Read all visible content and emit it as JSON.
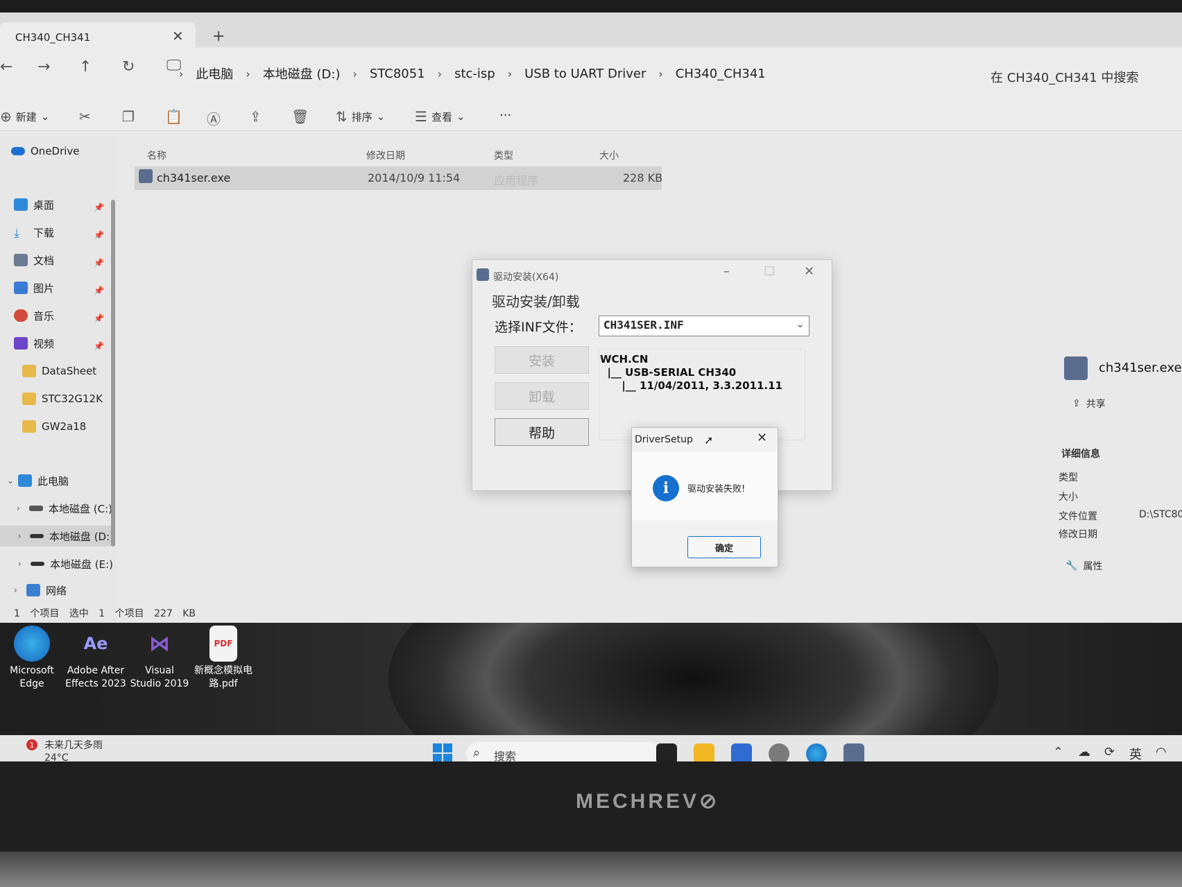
{
  "explorer": {
    "tab_title": "CH340_CH341",
    "tab_close": "✕",
    "tab_new": "+",
    "breadcrumbs": [
      "此电脑",
      "本地磁盘 (D:)",
      "STC8051",
      "stc-isp",
      "USB to UART Driver",
      "CH340_CH341"
    ],
    "search_placeholder": "在 CH340_CH341 中搜索",
    "toolbar": {
      "new_label": "新建",
      "sort_label": "排序",
      "view_label": "查看",
      "more_label": "···"
    },
    "sidebar": {
      "onedrive": "OneDrive",
      "quick": [
        "桌面",
        "下载",
        "文档",
        "图片",
        "音乐",
        "视频"
      ],
      "folders": [
        "DataSheet",
        "STC32G12K",
        "GW2a18"
      ],
      "this_pc": "此电脑",
      "drives": [
        "本地磁盘 (C:)",
        "本地磁盘 (D:)",
        "本地磁盘 (E:)"
      ],
      "network": "网络"
    },
    "columns": {
      "name": "名称",
      "modified": "修改日期",
      "type": "类型",
      "size": "大小"
    },
    "files": [
      {
        "name": "ch341ser.exe",
        "modified": "2014/10/9 11:54",
        "type": "应用程序",
        "size": "228 KB"
      }
    ],
    "status": {
      "count": "1 个项目",
      "selected": "选中 1 个项目  227 KB"
    },
    "details": {
      "file_name": "ch341ser.exe",
      "share_label": "共享",
      "section": "详细信息",
      "fields": [
        "类型",
        "大小",
        "文件位置",
        "修改日期"
      ],
      "location_value": "D:\\STC80",
      "properties_label": "属性"
    }
  },
  "driver_dialog": {
    "title": "驱动安装(X64)",
    "group_label": "驱动安装/卸载",
    "inf_label": "选择INF文件：",
    "inf_value": "CH341SER.INF",
    "buttons": {
      "install": "安装",
      "uninstall": "卸载",
      "help": "帮助"
    },
    "info_lines": [
      "WCH.CN",
      "  |__ USB-SERIAL CH340",
      "      |__ 11/04/2011, 3.3.2011.11"
    ]
  },
  "message_box": {
    "title": "DriverSetup",
    "message": "驱动安装失败!",
    "ok_label": "确定"
  },
  "desktop_icons": [
    {
      "label_1": "Microsoft",
      "label_2": "Edge"
    },
    {
      "label_1": "Adobe After",
      "label_2": "Effects 2023"
    },
    {
      "label_1": "Visual",
      "label_2": "Studio 2019"
    },
    {
      "label_1": "新概念模拟电",
      "label_2": "路.pdf"
    }
  ],
  "taskbar": {
    "weather_text": "未来几天多雨",
    "temperature": "24°C",
    "weather_badge": "1",
    "search_placeholder": "搜索",
    "ime": "英"
  },
  "laptop_brand": "MECHREV⊘",
  "colors": {
    "accent": "#1570d0",
    "selection": "#d2d2d2"
  }
}
